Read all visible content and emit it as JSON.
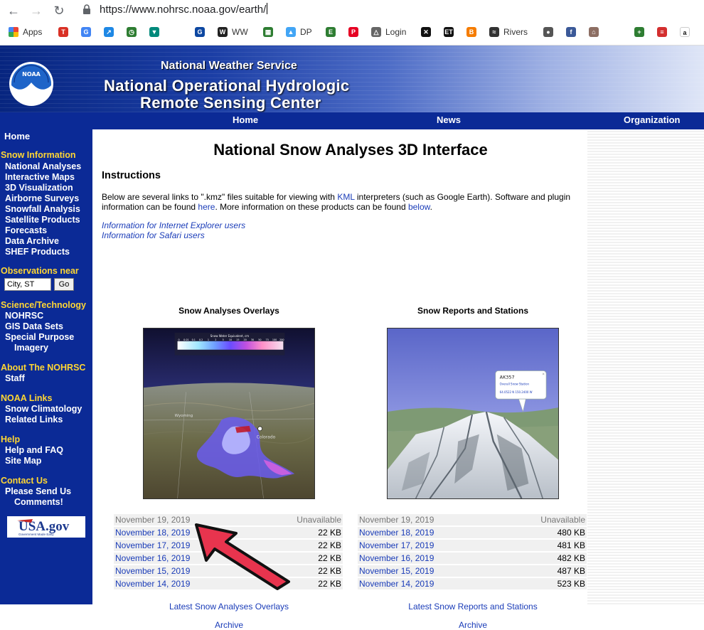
{
  "browser": {
    "url": "https://www.nohrsc.noaa.gov/earth/",
    "bookmarks": [
      {
        "label": "Apps",
        "icon": "apps-grid-icon"
      },
      {
        "label": "",
        "icon": "t-bookmark-icon",
        "color": "#d93025",
        "glyph": "T"
      },
      {
        "label": "",
        "icon": "google-icon",
        "color": "#4285f4",
        "glyph": "G"
      },
      {
        "label": "",
        "icon": "chart-bookmark-icon",
        "color": "#1e88e5",
        "glyph": "↗"
      },
      {
        "label": "",
        "icon": "clock-bookmark-icon",
        "color": "#2e7d32",
        "glyph": "◷"
      },
      {
        "label": "",
        "icon": "shield-bookmark-icon",
        "color": "#00897b",
        "glyph": "▼"
      },
      {
        "label": "",
        "icon": "g-bookmark-icon",
        "color": "#0d47a1",
        "glyph": "G"
      },
      {
        "label": "WW",
        "icon": "ww-bookmark-icon",
        "color": "#222222",
        "glyph": "W"
      },
      {
        "label": "",
        "icon": "map-bookmark-icon",
        "color": "#2e7d32",
        "glyph": "▦"
      },
      {
        "label": "DP",
        "icon": "dp-bookmark-icon",
        "color": "#42a5f5",
        "glyph": "▲"
      },
      {
        "label": "",
        "icon": "evernote-icon",
        "color": "#2e7d32",
        "glyph": "E"
      },
      {
        "label": "",
        "icon": "pinterest-icon",
        "color": "#e60023",
        "glyph": "P"
      },
      {
        "label": "Login",
        "icon": "triangle-login-icon",
        "color": "#666666",
        "glyph": "△"
      },
      {
        "label": "",
        "icon": "butterfly-icon",
        "color": "#111111",
        "glyph": "✕"
      },
      {
        "label": "",
        "icon": "et-bookmark-icon",
        "color": "#111111",
        "glyph": "ET"
      },
      {
        "label": "",
        "icon": "b-bookmark-icon",
        "color": "#f57c00",
        "glyph": "B"
      },
      {
        "label": "Rivers",
        "icon": "rivers-icon",
        "color": "#333333",
        "glyph": "≈"
      },
      {
        "label": "",
        "icon": "globe-bookmark-icon",
        "color": "#555555",
        "glyph": "●"
      },
      {
        "label": "",
        "icon": "facebook-icon",
        "color": "#3b5998",
        "glyph": "f"
      },
      {
        "label": "",
        "icon": "house-bookmark-icon",
        "color": "#8d6e63",
        "glyph": "⌂"
      },
      {
        "label": "",
        "icon": "cross-bookmark-icon",
        "color": "#2e7d32",
        "glyph": "+"
      },
      {
        "label": "",
        "icon": "red-bars-icon",
        "color": "#d32f2f",
        "glyph": "≡"
      },
      {
        "label": "",
        "icon": "amazon-icon",
        "color": "#ffffff",
        "glyph": "a"
      }
    ]
  },
  "header": {
    "agency": "National Weather Service",
    "center_line1": "National Operational Hydrologic",
    "center_line2": "Remote Sensing Center",
    "nav": [
      "Home",
      "News",
      "Organization"
    ]
  },
  "sidebar": {
    "home": "Home",
    "snow_info_heading": "Snow Information",
    "snow_info_items": [
      "National Analyses",
      "Interactive Maps",
      "3D Visualization",
      "Airborne Surveys",
      "Snowfall Analysis",
      "Satellite Products",
      "Forecasts",
      "Data Archive",
      "SHEF Products"
    ],
    "obs_heading": "Observations near",
    "obs_input_value": "City, ST",
    "obs_go": "Go",
    "sci_heading": "Science/Technology",
    "sci_items": [
      "NOHRSC",
      "GIS Data Sets",
      "Special Purpose",
      "Imagery"
    ],
    "about_heading": "About The NOHRSC",
    "about_items": [
      "Staff"
    ],
    "noaa_heading": "NOAA Links",
    "noaa_items": [
      "Snow Climatology",
      "Related Links"
    ],
    "help_heading": "Help",
    "help_items": [
      "Help and FAQ",
      "Site Map"
    ],
    "contact_heading": "Contact Us",
    "contact_items": [
      "Please Send Us",
      "Comments!"
    ],
    "usa_gov": "USA.gov",
    "usa_gov_tagline": "Government Made Easy"
  },
  "main": {
    "title": "National Snow Analyses 3D Interface",
    "instructions_heading": "Instructions",
    "para1_a": "Below are several links to \".kmz\" files suitable for viewing with ",
    "para1_kml": "KML",
    "para1_b": " interpreters (such as Google Earth). Software and plugin",
    "para2_a": "information can be found ",
    "para2_here": "here",
    "para2_b": ". More information on these products can be found ",
    "para2_below": "below",
    "para2_c": ".",
    "ie_link": "Information for Internet Explorer users",
    "safari_link": "Information for Safari users",
    "overlays": {
      "title": "Snow Analyses Overlays",
      "legend_title": "Snow Water Equivalent, cm",
      "legend_ticks": [
        "0",
        "0.01",
        "0.1",
        "0.2",
        "1",
        "2",
        "5",
        "10",
        "15",
        "20",
        "30",
        "50",
        "75",
        "100",
        "200"
      ],
      "map_labels": {
        "wyoming": "Wyoming",
        "colorado": "Colorado"
      },
      "rows": [
        {
          "date": "November 19, 2019",
          "size": "Unavailable"
        },
        {
          "date": "November 18, 2019",
          "size": "22 KB"
        },
        {
          "date": "November 17, 2019",
          "size": "22 KB"
        },
        {
          "date": "November 16, 2019",
          "size": "22 KB"
        },
        {
          "date": "November 15, 2019",
          "size": "22 KB"
        },
        {
          "date": "November 14, 2019",
          "size": "22 KB"
        }
      ],
      "latest_link": "Latest Snow Analyses Overlays",
      "archive_link": "Archive"
    },
    "reports": {
      "title": "Snow Reports and Stations",
      "popup_id": "AK357",
      "popup_line2": "Overall Snow Station",
      "popup_line3": "64.0522 N  150.2400 W",
      "rows": [
        {
          "date": "November 19, 2019",
          "size": "Unavailable"
        },
        {
          "date": "November 18, 2019",
          "size": "480 KB"
        },
        {
          "date": "November 17, 2019",
          "size": "481 KB"
        },
        {
          "date": "November 16, 2019",
          "size": "482 KB"
        },
        {
          "date": "November 15, 2019",
          "size": "487 KB"
        },
        {
          "date": "November 14, 2019",
          "size": "523 KB"
        }
      ],
      "latest_link": "Latest Snow Reports and Stations",
      "archive_link": "Archive"
    }
  },
  "colors": {
    "navy": "#0b2a96",
    "heading_yellow": "#ffd633",
    "link_blue": "#1a3cb8",
    "annotation_red": "#e8344e"
  }
}
